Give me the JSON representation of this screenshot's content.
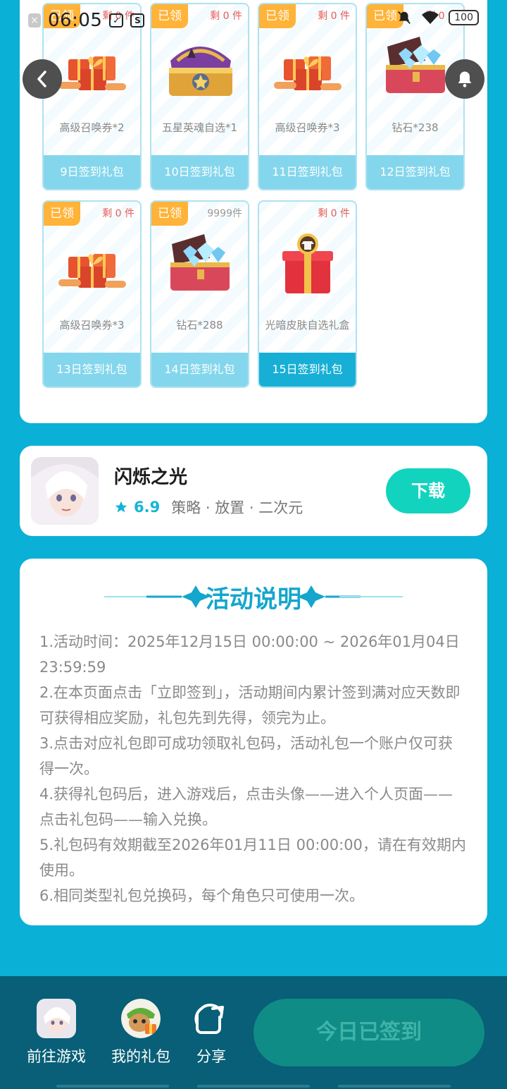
{
  "status_bar": {
    "time": "06:05",
    "battery": "100"
  },
  "rewards": [
    {
      "claimed_label": "已领",
      "remaining": "剩 0 件",
      "name": "高级召唤券*2",
      "day_label": "9日签到礼包",
      "art": "red-gift-pile",
      "claimed": true,
      "active": false
    },
    {
      "claimed_label": "已领",
      "remaining": "剩 0 件",
      "name": "五星英魂自选*1",
      "day_label": "10日签到礼包",
      "art": "golden-chest",
      "claimed": true,
      "active": false
    },
    {
      "claimed_label": "已领",
      "remaining": "剩 0 件",
      "name": "高级召唤券*3",
      "day_label": "11日签到礼包",
      "art": "red-gift-pile",
      "claimed": true,
      "active": false
    },
    {
      "claimed_label": "已领",
      "remaining": "剩 0 件",
      "name": "钻石*238",
      "day_label": "12日签到礼包",
      "art": "diamond-chest",
      "claimed": true,
      "active": false
    },
    {
      "claimed_label": "已领",
      "remaining": "剩 0 件",
      "name": "高级召唤券*3",
      "day_label": "13日签到礼包",
      "art": "red-gift-pile",
      "claimed": true,
      "active": false
    },
    {
      "claimed_label": "已领",
      "remaining": "9999件",
      "name": "钻石*288",
      "day_label": "14日签到礼包",
      "art": "diamond-chest",
      "claimed": true,
      "active": false
    },
    {
      "claimed_label": "",
      "remaining": "剩 0 件",
      "name": "光暗皮肤自选礼盒",
      "day_label": "15日签到礼包",
      "art": "skin-gift-box",
      "claimed": false,
      "active": true
    }
  ],
  "game": {
    "title": "闪烁之光",
    "rating": "6.9",
    "genres": "策略 · 放置 · 二次元",
    "download_label": "下载"
  },
  "rules": {
    "title": "活动说明",
    "items": [
      "1.活动时间：2025年12月15日 00:00:00 ~ 2026年01月04日 23:59:59",
      "2.在本页面点击「立即签到」，活动期间内累计签到满对应天数即可获得相应奖励，礼包先到先得，领完为止。",
      "3.点击对应礼包即可成功领取礼包码，活动礼包一个账户仅可获得一次。",
      "4.获得礼包码后，进入游戏后，点击头像——进入个人页面——点击礼包码——输入兑换。",
      "5.礼包码有效期截至2026年01月11日 00:00:00，请在有效期内使用。",
      "6.相同类型礼包兑换码，每个角色只可使用一次。"
    ]
  },
  "bottom_bar": {
    "go_game_label": "前往游戏",
    "my_gifts_label": "我的礼包",
    "share_label": "分享",
    "signed_label": "今日已签到"
  },
  "colors": {
    "page_bg": "#0bb0d6",
    "tag_orange": "#ffb338",
    "footer_light": "#84d6ec",
    "footer_active": "#17afd5",
    "download_green": "#12d4be",
    "bottom_bar": "#085f77"
  }
}
